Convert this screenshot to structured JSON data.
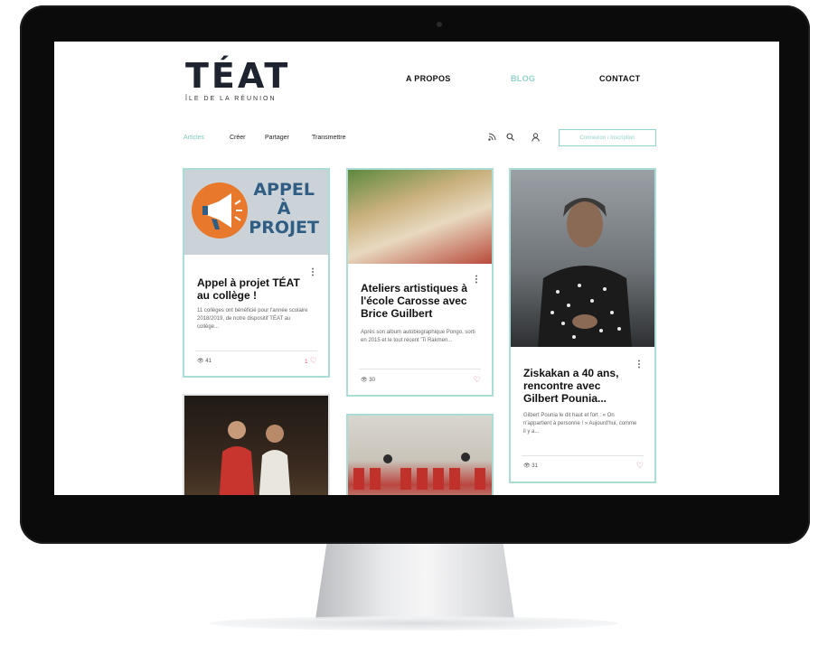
{
  "site": {
    "logo_title": "TÉAT",
    "logo_subtitle": "ÎLE DE LA RÉUNION"
  },
  "nav": {
    "apropos": "A PROPOS",
    "blog": "BLOG",
    "contact": "CONTACT"
  },
  "subnav": {
    "items": [
      "Articles",
      "Créer",
      "Partager",
      "Transmettre"
    ],
    "cta": "Connexion / Inscription"
  },
  "posts": [
    {
      "title": "Appel à projet TÉAT au collège !",
      "excerpt": "11 collèges ont bénéficié pour l'année scolaire 2018/2019, de notre dispositif TÉAT au collège...",
      "views": "41",
      "likes": "1",
      "image_text": [
        "APPEL",
        "À",
        "PROJET"
      ]
    },
    {
      "title": "Ateliers artistiques à l'école Carosse avec Brice Guilbert",
      "excerpt": "Après son album autobiographique Pongo, sorti en 2015 et le tout récent 'Ti Rakmen...",
      "views": "30",
      "likes": ""
    },
    {
      "title": "Ziskakan a 40 ans, rencontre avec Gilbert Pounia...",
      "excerpt": "Gilbert Pounia le dit haut et fort : « On n'appartient à personne ! » Aujourd'hui, comme il y a...",
      "views": "31",
      "likes": ""
    }
  ],
  "colors": {
    "accent": "#8fd3cb",
    "card_border": "#a9ddd6",
    "heart": "#e05566",
    "logo": "#1d2430",
    "appel_orange": "#e8792c",
    "appel_blue": "#2f5d83"
  },
  "icons": [
    "rss-icon",
    "search-icon",
    "user-icon",
    "megaphone-icon",
    "eye-icon",
    "heart-icon",
    "more-icon"
  ]
}
